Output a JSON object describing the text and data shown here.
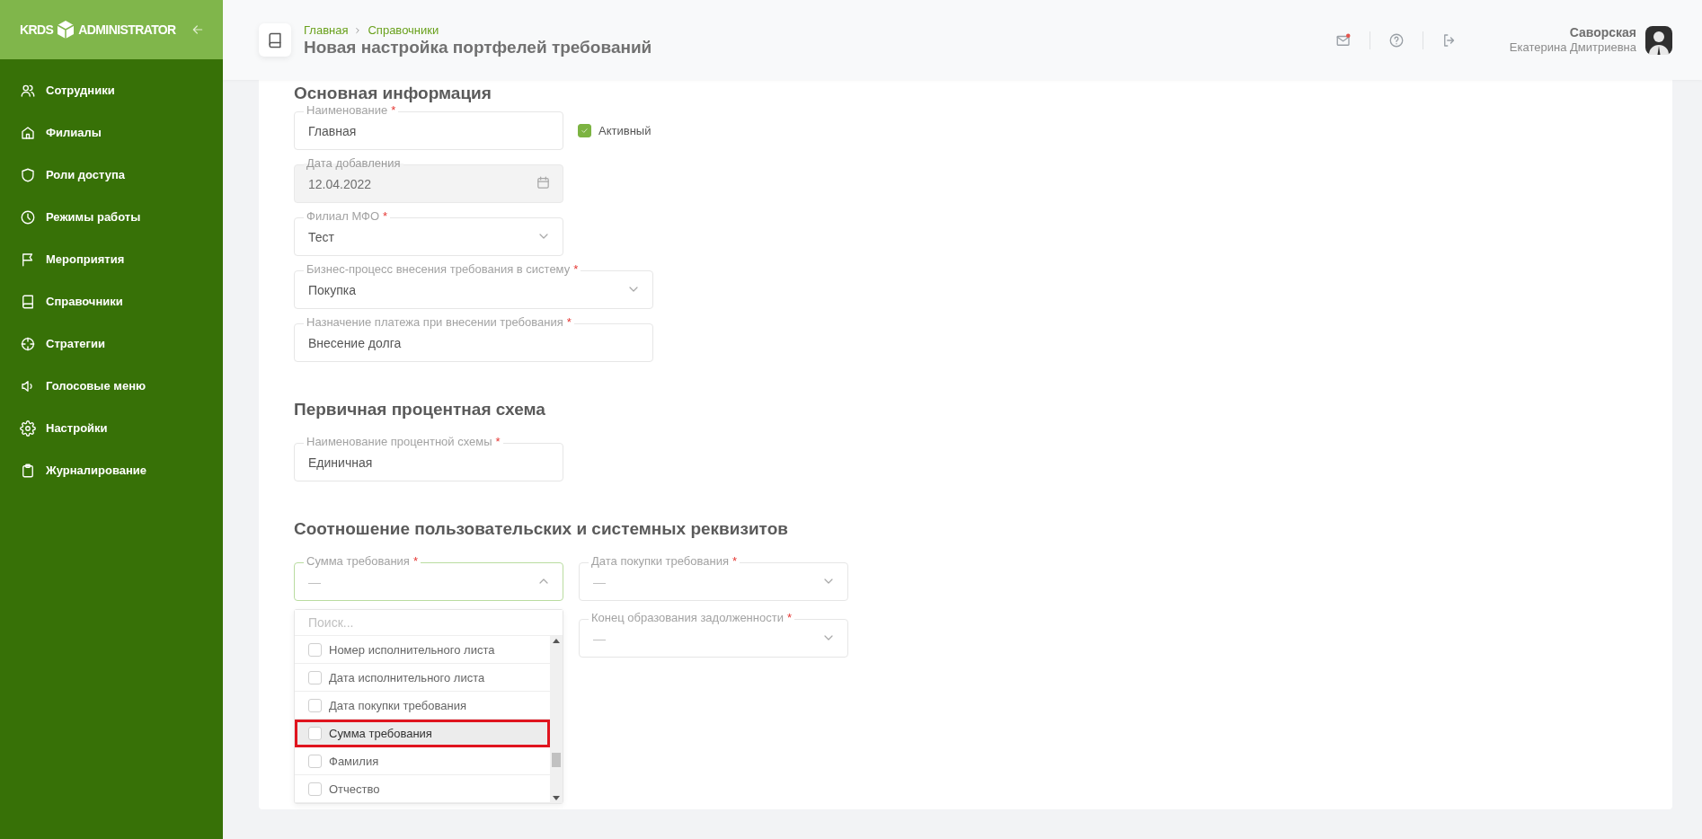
{
  "sidebar": {
    "logo": {
      "left": "KRDS",
      "right": "ADMINISTRATOR"
    },
    "items": [
      {
        "label": "Сотрудники"
      },
      {
        "label": "Филиалы"
      },
      {
        "label": "Роли доступа"
      },
      {
        "label": "Режимы работы"
      },
      {
        "label": "Мероприятия"
      },
      {
        "label": "Справочники"
      },
      {
        "label": "Стратегии"
      },
      {
        "label": "Голосовые меню"
      },
      {
        "label": "Настройки"
      },
      {
        "label": "Журналирование"
      }
    ]
  },
  "header": {
    "breadcrumbs": [
      "Главная",
      "Справочники"
    ],
    "title": "Новая настройка портфелей требований",
    "mail_unread": true,
    "user": {
      "surname": "Саворская",
      "name": "Екатерина Дмитриевна"
    }
  },
  "sections": [
    {
      "title": "Основная информация",
      "checkbox": {
        "label": "Активный",
        "checked": true
      },
      "fields": [
        {
          "kind": "text",
          "label": "Наименование",
          "required_mark": "*",
          "disabled": false,
          "value": "Главная"
        },
        {
          "kind": "date",
          "label": "Дата добавления",
          "disabled": true,
          "value": "12.04.2022"
        },
        {
          "kind": "select",
          "label": "Филиал МФО",
          "required_mark": "*",
          "disabled": false,
          "expanded": false,
          "value": "Тест"
        },
        {
          "kind": "select",
          "label": "Бизнес-процесс внесения требования в систему",
          "required_mark": "*",
          "disabled": false,
          "expanded": false,
          "value": "Покупка"
        },
        {
          "kind": "text",
          "label": "Назначение платежа при внесении требования",
          "required_mark": "*",
          "disabled": false,
          "value": "Внесение долга"
        }
      ]
    },
    {
      "title": "Первичная процентная схема",
      "fields": [
        {
          "kind": "text",
          "label": "Наименование процентной схемы",
          "required_mark": "*",
          "disabled": false,
          "value": "Единичная"
        }
      ]
    },
    {
      "title": "Соотношение пользовательских и системных реквизитов",
      "fields": [
        {
          "kind": "select",
          "label": "Сумма требования",
          "required_mark": "*",
          "disabled": false,
          "expanded": true,
          "placeholder": "—",
          "dropdown": {
            "search_placeholder": "Поиск...",
            "options": [
              {
                "label": "Номер исполнительного листа",
                "checked": false,
                "highlighted": false
              },
              {
                "label": "Дата исполнительного листа",
                "checked": false,
                "highlighted": false
              },
              {
                "label": "Дата покупки требования",
                "checked": false,
                "highlighted": false
              },
              {
                "label": "Сумма требования",
                "checked": false,
                "highlighted": true
              },
              {
                "label": "Фамилия",
                "checked": false,
                "highlighted": false
              },
              {
                "label": "Отчество",
                "checked": false,
                "highlighted": false
              }
            ]
          }
        },
        {
          "kind": "select",
          "label": "Дата покупки требования",
          "required_mark": "*",
          "disabled": false,
          "expanded": false,
          "placeholder": "—"
        },
        {
          "kind": "select",
          "label": "Конец образования задолженности",
          "required_mark": "*",
          "disabled": false,
          "expanded": false,
          "placeholder": "—"
        }
      ]
    }
  ]
}
